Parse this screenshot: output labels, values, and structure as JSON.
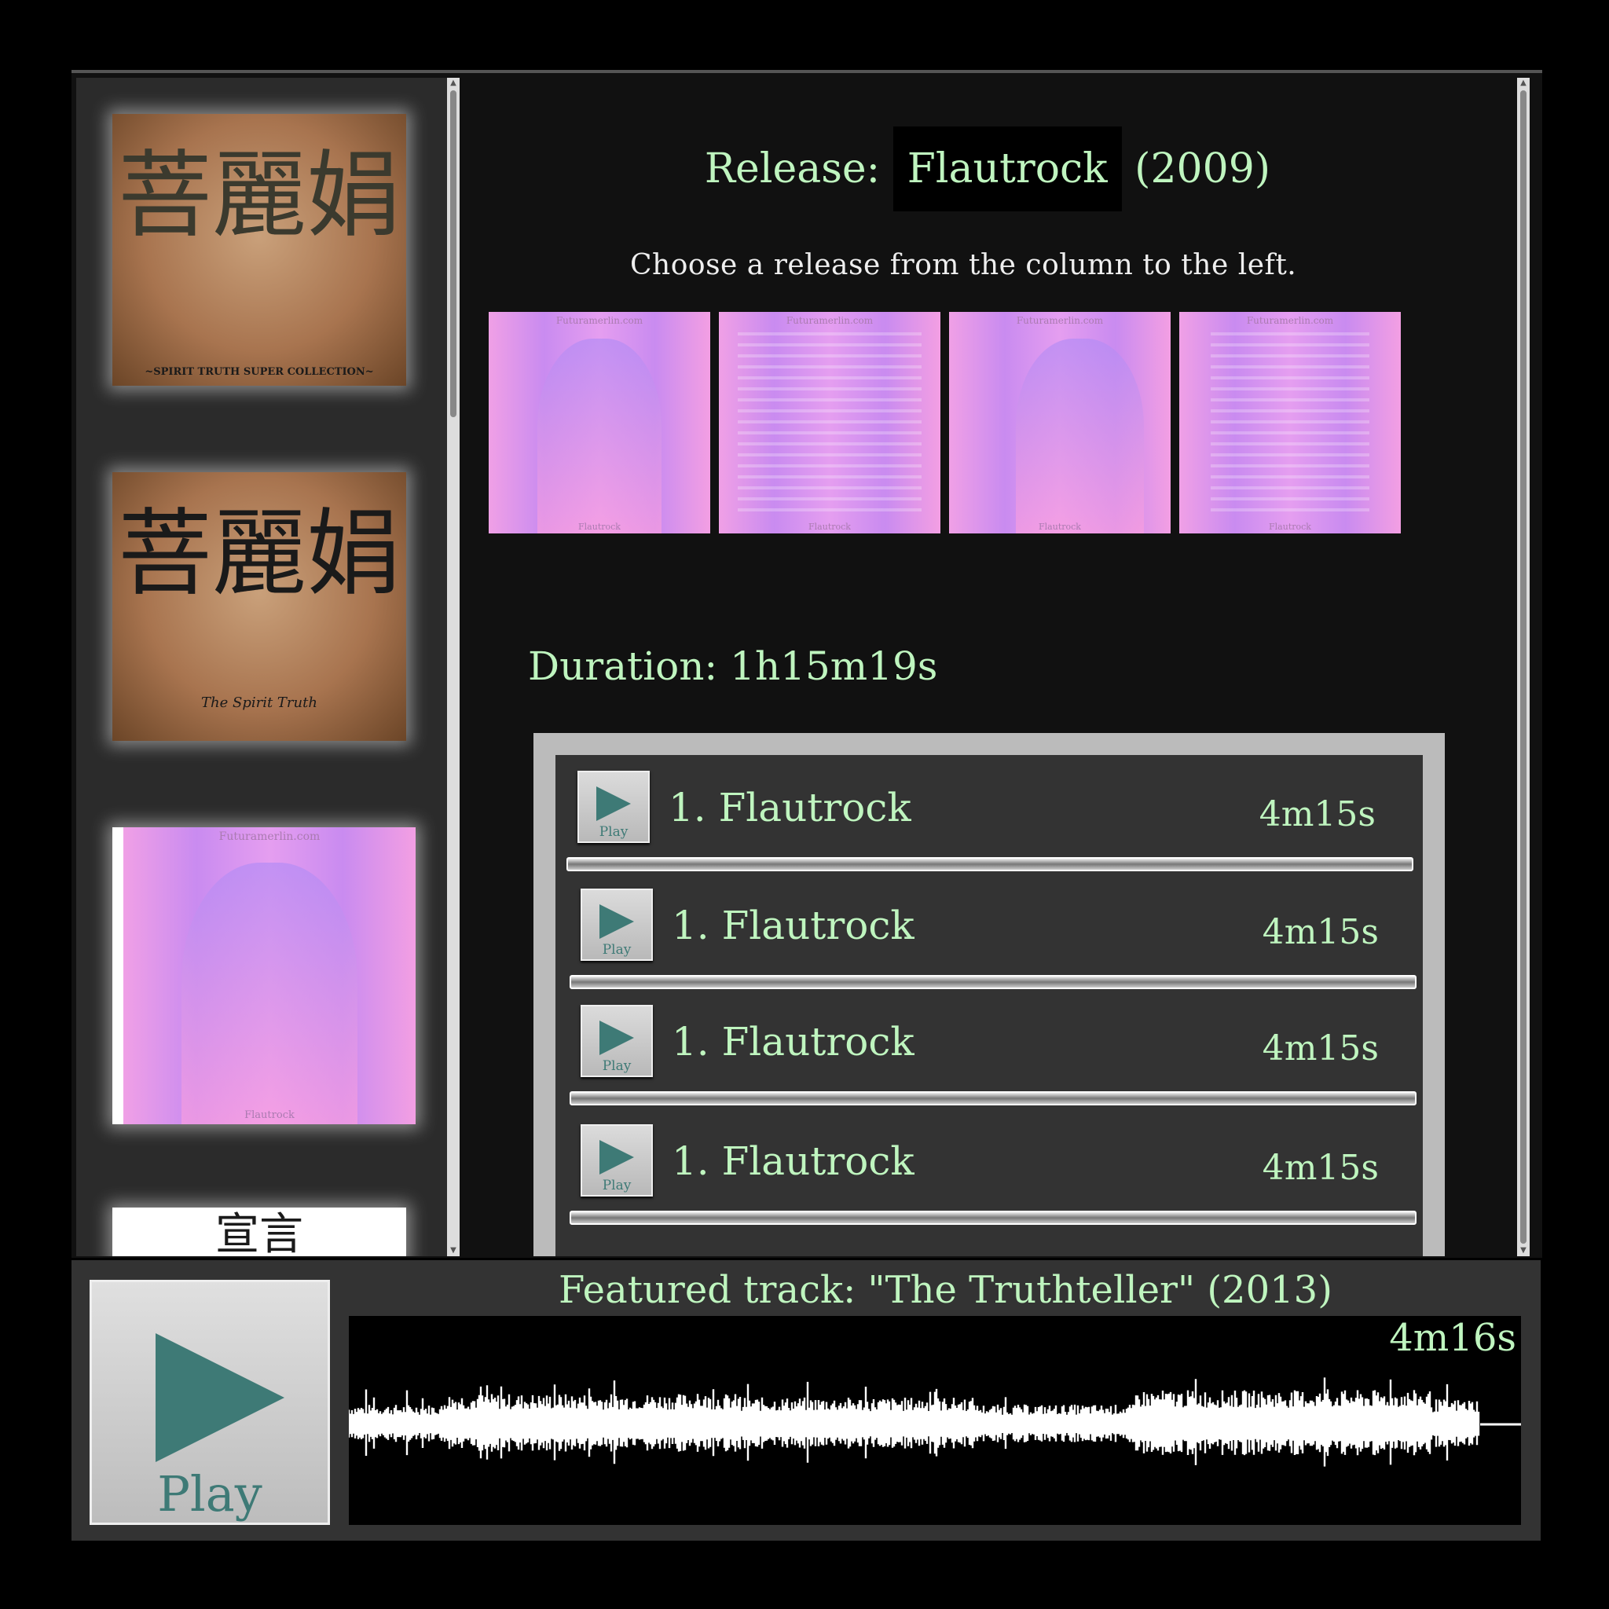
{
  "sidebar": {
    "covers": [
      {
        "name": "spirit-truth-super-collection-cover",
        "glyph": "菩麗娟",
        "subtitle": "~SPIRIT TRUTH SUPER COLLECTION~"
      },
      {
        "name": "spirit-truth-internet-demos-cover",
        "glyph": "菩麗娟",
        "subtitle": "The Spirit Truth"
      },
      {
        "name": "flautrock-cover",
        "site": "Futuramerlin.com",
        "foot": "Flautrock"
      },
      {
        "name": "partial-cover",
        "glyph": "宣言"
      }
    ]
  },
  "release": {
    "label": "Release:",
    "name": "Flautrock",
    "year": "(2009)",
    "instruction": "Choose a release from the column to the left.",
    "images": [
      {
        "site": "Futuramerlin.com",
        "foot": "Flautrock"
      },
      {
        "site": "Futuramerlin.com",
        "foot": "Flautrock"
      },
      {
        "site": "Futuramerlin.com",
        "foot": "Flautrock"
      },
      {
        "site": "Futuramerlin.com",
        "foot": "Flautrock"
      }
    ],
    "duration": "Duration: 1h15m19s"
  },
  "tracks": [
    {
      "button": "Play",
      "title": "1. Flautrock",
      "duration": "4m15s"
    },
    {
      "button": "Play",
      "title": "1. Flautrock",
      "duration": "4m15s"
    },
    {
      "button": "Play",
      "title": "1. Flautrock",
      "duration": "4m15s"
    },
    {
      "button": "Play",
      "title": "1. Flautrock",
      "duration": "4m15s"
    }
  ],
  "player": {
    "button": "Play",
    "featured": "Featured track: \"The Truthteller\" (2013)",
    "duration": "4m16s"
  },
  "colors": {
    "accent_text": "#bff5bf",
    "play_icon": "#3e7a76",
    "background": "#000000"
  }
}
